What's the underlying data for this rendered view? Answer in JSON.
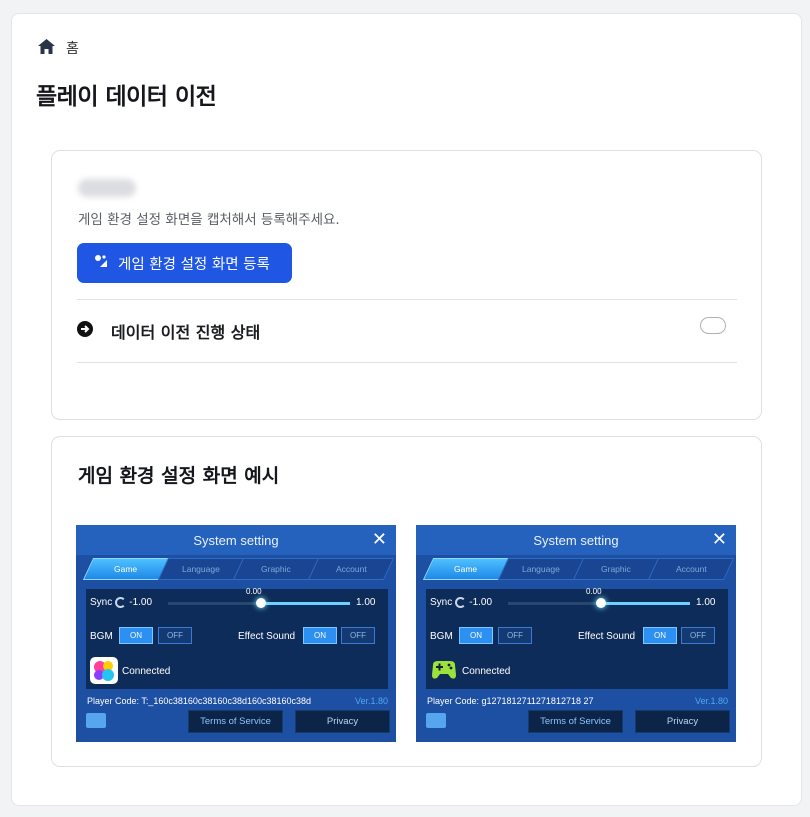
{
  "breadcrumb": {
    "home_icon": "home-icon",
    "label": "홈"
  },
  "page_title": "플레이 데이터 이전",
  "upload_card": {
    "description": "게임 환경 설정 화면을 캡처해서 등록해주세요.",
    "button_label": "게임 환경 설정 화면 등록",
    "button_icon": "upload-icon",
    "status_label": "데이터 이전 진행 상태",
    "status_icon": "arrow-right-circle-icon",
    "status_toggle_on": false
  },
  "example_card": {
    "title": "게임 환경 설정 화면 예시"
  },
  "game_screens": [
    {
      "title": "System setting",
      "tabs": [
        "Game",
        "Language",
        "Graphic",
        "Account"
      ],
      "active_tab": "Game",
      "sync_label": "Sync",
      "sync_min": "-1.00",
      "sync_value": "0.00",
      "sync_max": "1.00",
      "bgm_label": "BGM",
      "on_label": "ON",
      "off_label": "OFF",
      "effect_label": "Effect Sound",
      "connected_label": "Connected",
      "connected_icon": "game-center-icon",
      "player_code": "Player Code: T:_160c38160c38160c38d160c38160c38d",
      "version": "Ver.1.80",
      "terms_label": "Terms of Service",
      "privacy_label": "Privacy"
    },
    {
      "title": "System setting",
      "tabs": [
        "Game",
        "Language",
        "Graphic",
        "Account"
      ],
      "active_tab": "Game",
      "sync_label": "Sync",
      "sync_min": "-1.00",
      "sync_value": "0.00",
      "sync_max": "1.00",
      "bgm_label": "BGM",
      "on_label": "ON",
      "off_label": "OFF",
      "effect_label": "Effect Sound",
      "connected_label": "Connected",
      "connected_icon": "gamepad-icon",
      "player_code": "Player Code: g1271812711271812718 27",
      "version": "Ver.1.80",
      "terms_label": "Terms of Service",
      "privacy_label": "Privacy"
    }
  ],
  "colors": {
    "primary": "#1f56e3",
    "game_bg": "#1d4fa3"
  }
}
